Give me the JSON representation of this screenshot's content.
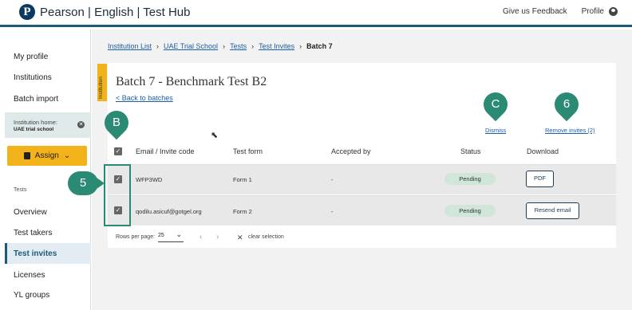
{
  "header": {
    "logo_letter": "P",
    "brand": "Pearson",
    "product": "| English | Test Hub",
    "feedback": "Give us Feedback",
    "profile": "Profile"
  },
  "sidebar": {
    "items": [
      {
        "label": "My profile"
      },
      {
        "label": "Institutions"
      },
      {
        "label": "Batch import"
      }
    ],
    "institution_home_label": "Institution home:",
    "institution_name": "UAE trial school",
    "assign_label": "Assign",
    "tests_section": "Tests",
    "tests_items": [
      {
        "label": "Overview"
      },
      {
        "label": "Test takers"
      },
      {
        "label": "Test invites"
      },
      {
        "label": "Licenses"
      },
      {
        "label": "YL groups"
      }
    ]
  },
  "breadcrumb": [
    "Institution List",
    "UAE Trial School",
    "Tests",
    "Test Invites",
    "Batch 7"
  ],
  "institution_tag": "Institution",
  "page_title": "Batch 7 - Benchmark Test B2",
  "back_link": "< Back to batches",
  "actions": {
    "dismiss": "Dismiss",
    "remove": "Remove invites (2)"
  },
  "table": {
    "headers": [
      "Email / Invite code",
      "Test form",
      "Accepted by",
      "Status",
      "Download"
    ],
    "rows": [
      {
        "email": "WFP3WD",
        "form": "Form 1",
        "accepted": "-",
        "status": "Pending",
        "download": "PDF"
      },
      {
        "email": "qodilu.asicuf@gotgel.org",
        "form": "Form 2",
        "accepted": "-",
        "status": "Pending",
        "download": "Resend email"
      }
    ]
  },
  "pager": {
    "label": "Rows per page:",
    "value": "25",
    "clear": "clear selection",
    "prev": "‹",
    "next": "›"
  },
  "annotations": {
    "b": "B",
    "c": "C",
    "six": "6",
    "five": "5"
  },
  "colors": {
    "accent": "#f2b21a",
    "teal": "#2a8a74",
    "link": "#1b5fa8",
    "pending": "#cfe6d9"
  }
}
